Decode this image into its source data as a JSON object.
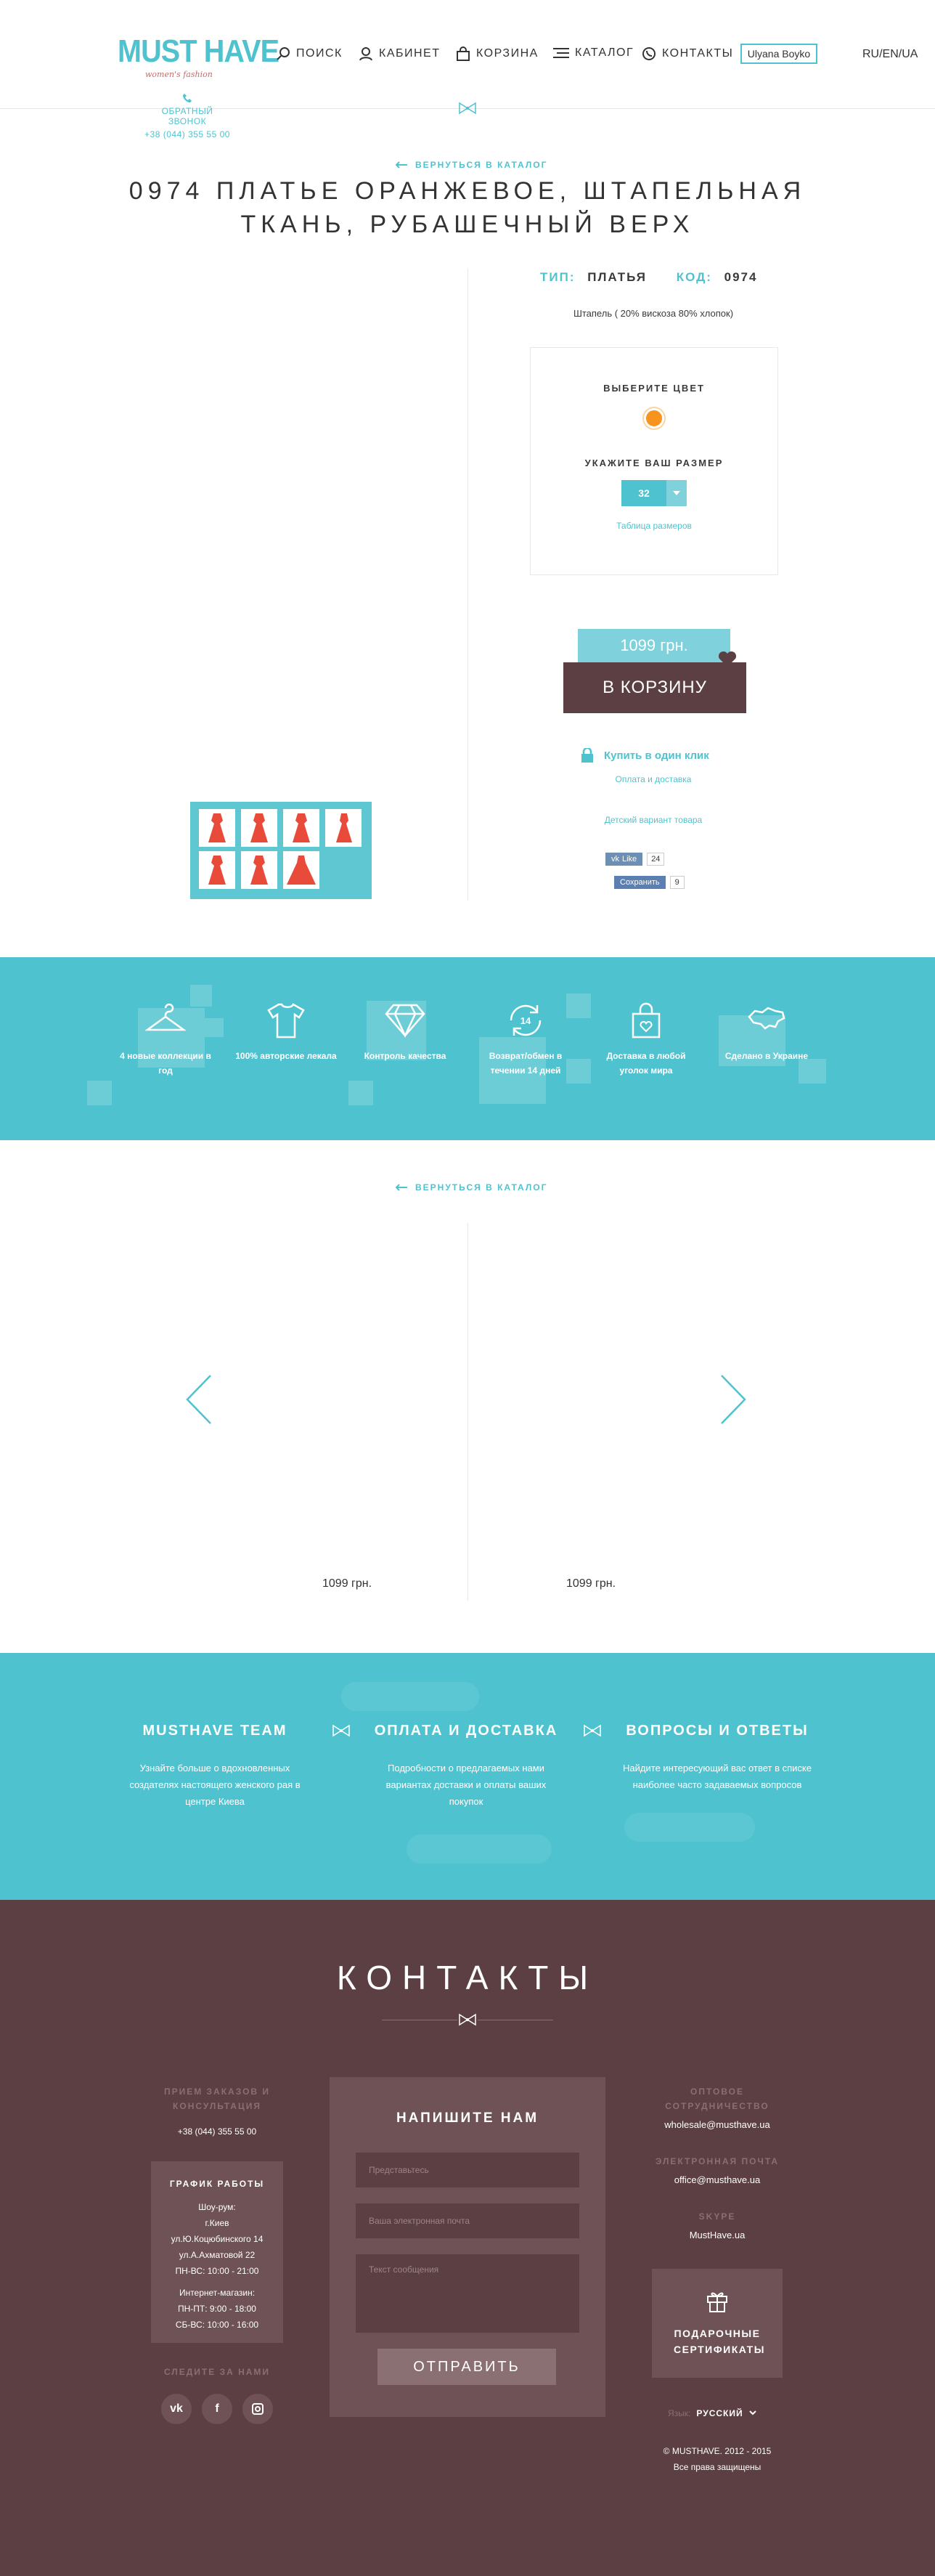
{
  "header": {
    "logo": "MUST HAVE",
    "logo_sub": "women's fashion",
    "nav": [
      "ПОИСК",
      "КАБИНЕТ",
      "КОРЗИНА",
      "КАТАЛОГ",
      "КОНТАКТЫ"
    ],
    "user": "Ulyana Boyko",
    "lang": "RU/EN/UA",
    "callback_label": "ОБРАТНЫЙ ЗВОНОК",
    "callback_phone": "+38 (044) 355 55 00"
  },
  "back_label": "ВЕРНУТЬСЯ В КАТАЛОГ",
  "product": {
    "title_line1": "0974 ПЛАТЬЕ ОРАНЖЕВОЕ, ШТАПЕЛЬНАЯ",
    "title_line2": "ТКАНЬ, РУБАШЕЧНЫЙ ВЕРХ",
    "type_label": "ТИП:",
    "type_value": "ПЛАТЬЯ",
    "code_label": "КОД:",
    "code_value": "0974",
    "material": "Штапель ( 20% вискоза 80% хлопок)",
    "choose_color": "ВЫБЕРИТЕ ЦВЕТ",
    "color": "#f7941d",
    "choose_size": "УКАЖИТЕ ВАШ РАЗМЕР",
    "size": "32",
    "size_table": "Таблица размеров",
    "price": "1099 грн.",
    "cart": "В КОРЗИНУ",
    "one_click": "Купить в один клик",
    "delivery": "Оплата и доставка",
    "kids": "Детский вариант товара",
    "vk_like": "Like",
    "vk_count": "24",
    "save": "Сохранить",
    "save_count": "9"
  },
  "features": [
    {
      "icon": "hanger-icon",
      "text": "4 новые коллекции в год"
    },
    {
      "icon": "shirt-icon",
      "text": "100% авторские лекала"
    },
    {
      "icon": "diamond-icon",
      "text": "Контроль качества"
    },
    {
      "icon": "return-14-icon",
      "text": "Возврат/обмен в течении 14 дней"
    },
    {
      "icon": "bag-heart-icon",
      "text": "Доставка в любой уголок мира"
    },
    {
      "icon": "ukraine-map-icon",
      "text": "Сделано в Украине"
    }
  ],
  "return_badge": "14",
  "related": {
    "prices": [
      "1099 грн.",
      "1099 грн."
    ]
  },
  "info": [
    {
      "title": "MUSTHAVE TEAM",
      "text": "Узнайте больше о вдохновленных создателях настоящего женского рая в центре Киева"
    },
    {
      "title": "ОПЛАТА И ДОСТАВКА",
      "text": "Подробности о предлагаемых нами вариантах доставки и оплаты ваших покупок"
    },
    {
      "title": "ВОПРОСЫ И ОТВЕТЫ",
      "text": "Найдите интересующий вас ответ в списке наиболее часто задаваемых вопросов"
    }
  ],
  "footer": {
    "title": "КОНТАКТЫ",
    "orders_label": "ПРИЕМ ЗАКАЗОВ И КОНСУЛЬТАЦИЯ",
    "orders_phone": "+38 (044) 355 55 00",
    "schedule_title": "ГРАФИК РАБОТЫ",
    "schedule": [
      "Шоу-рум:",
      "г.Киев",
      "ул.Ю.Коцюбинского 14",
      "ул.А.Ахматовой 22",
      "ПН-ВС: 10:00 - 21:00",
      "",
      "Интернет-магазин:",
      "ПН-ПТ: 9:00 - 18:00",
      "СБ-ВС: 10:00 - 16:00"
    ],
    "follow_label": "СЛЕДИТЕ ЗА НАМИ",
    "form_title": "НАПИШИТЕ НАМ",
    "name_placeholder": "Представьтесь",
    "email_placeholder": "Ваша электронная почта",
    "message_placeholder": "Текст сообщения",
    "send": "ОТПРАВИТЬ",
    "wholesale_label": "ОПТОВОЕ СОТРУДНИЧЕСТВО",
    "wholesale_value": "wholesale@musthave.ua",
    "email_label": "ЭЛЕКТРОННАЯ ПОЧТА",
    "email_value": "office@musthave.ua",
    "skype_label": "SKYPE",
    "skype_value": "MustHave.ua",
    "gift": "ПОДАРОЧНЫЕ СЕРТИФИКАТЫ",
    "lang_label": "Язык:",
    "lang_value": "РУССКИЙ",
    "copyright": "© MUSTHAVE. 2012 - 2015",
    "rights": "Все права защищены"
  }
}
